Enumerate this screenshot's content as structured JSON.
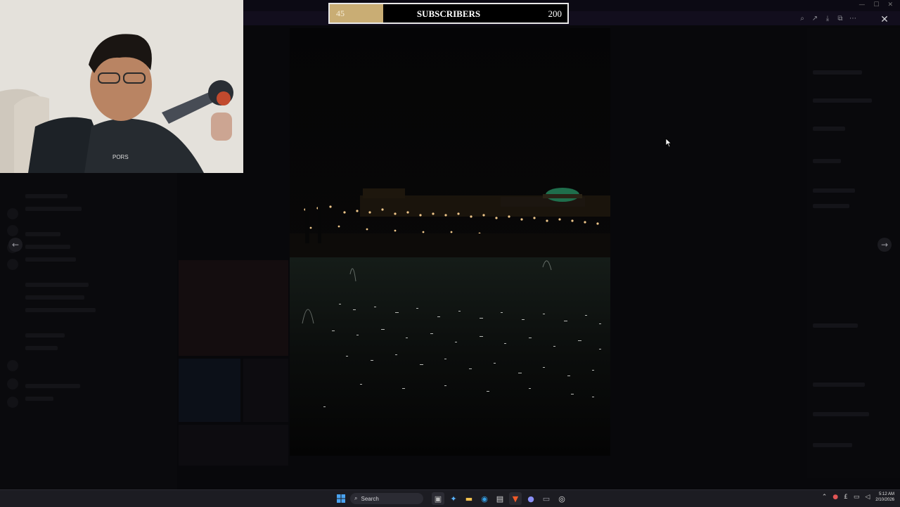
{
  "subscriber_bar": {
    "current": "45",
    "label": "SUBSCRIBERS",
    "goal": "200",
    "progress": 0.225,
    "fill_color": "#c9ad74"
  },
  "viewer": {
    "prev_icon": "←",
    "next_icon": "→",
    "close_icon": "✕",
    "tools": [
      "⌕",
      "↗",
      "⤓",
      "⧉",
      "⋯"
    ]
  },
  "window_controls": [
    "—",
    "☐",
    "✕"
  ],
  "taskbar": {
    "search_placeholder": "Search",
    "clock_time": "5:12 AM",
    "clock_date": "2/10/2026",
    "apps": [
      "file-explorer",
      "copilot",
      "folder",
      "edge",
      "store",
      "brave",
      "discord",
      "terminal",
      "recorder"
    ]
  }
}
